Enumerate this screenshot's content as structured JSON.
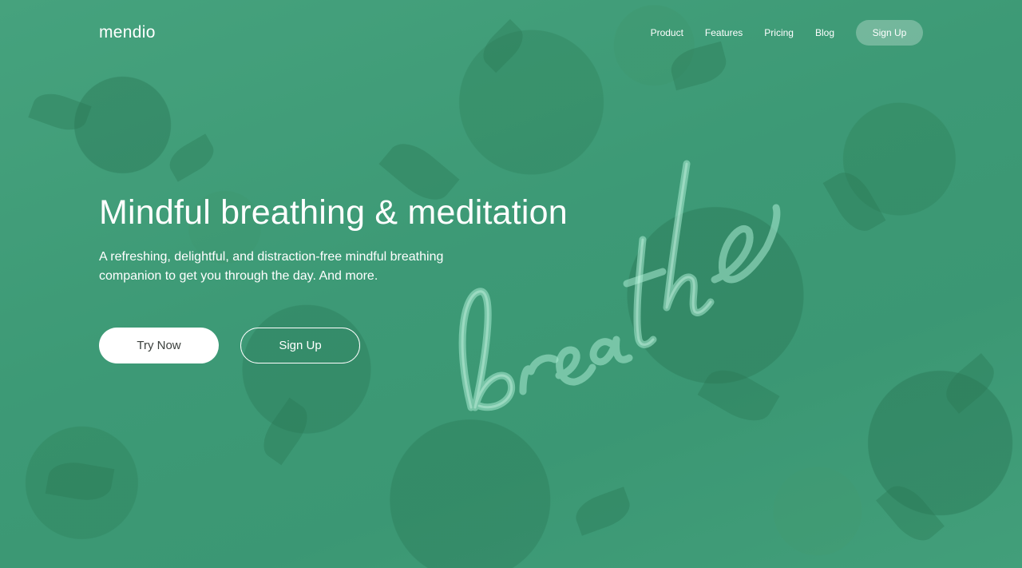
{
  "nav": {
    "logo": "mendio",
    "items": [
      {
        "label": "Product"
      },
      {
        "label": "Features"
      },
      {
        "label": "Pricing"
      },
      {
        "label": "Blog"
      }
    ],
    "signup_label": "Sign Up"
  },
  "hero": {
    "title": "Mindful breathing & meditation",
    "subtitle": "A refreshing, delightful, and distraction-free mindful breathing companion to get you through the day. And more.",
    "try_label": "Try Now",
    "signup_label": "Sign Up"
  },
  "background": {
    "neon_text": "breathe",
    "overlay_color": "#40a07a"
  }
}
